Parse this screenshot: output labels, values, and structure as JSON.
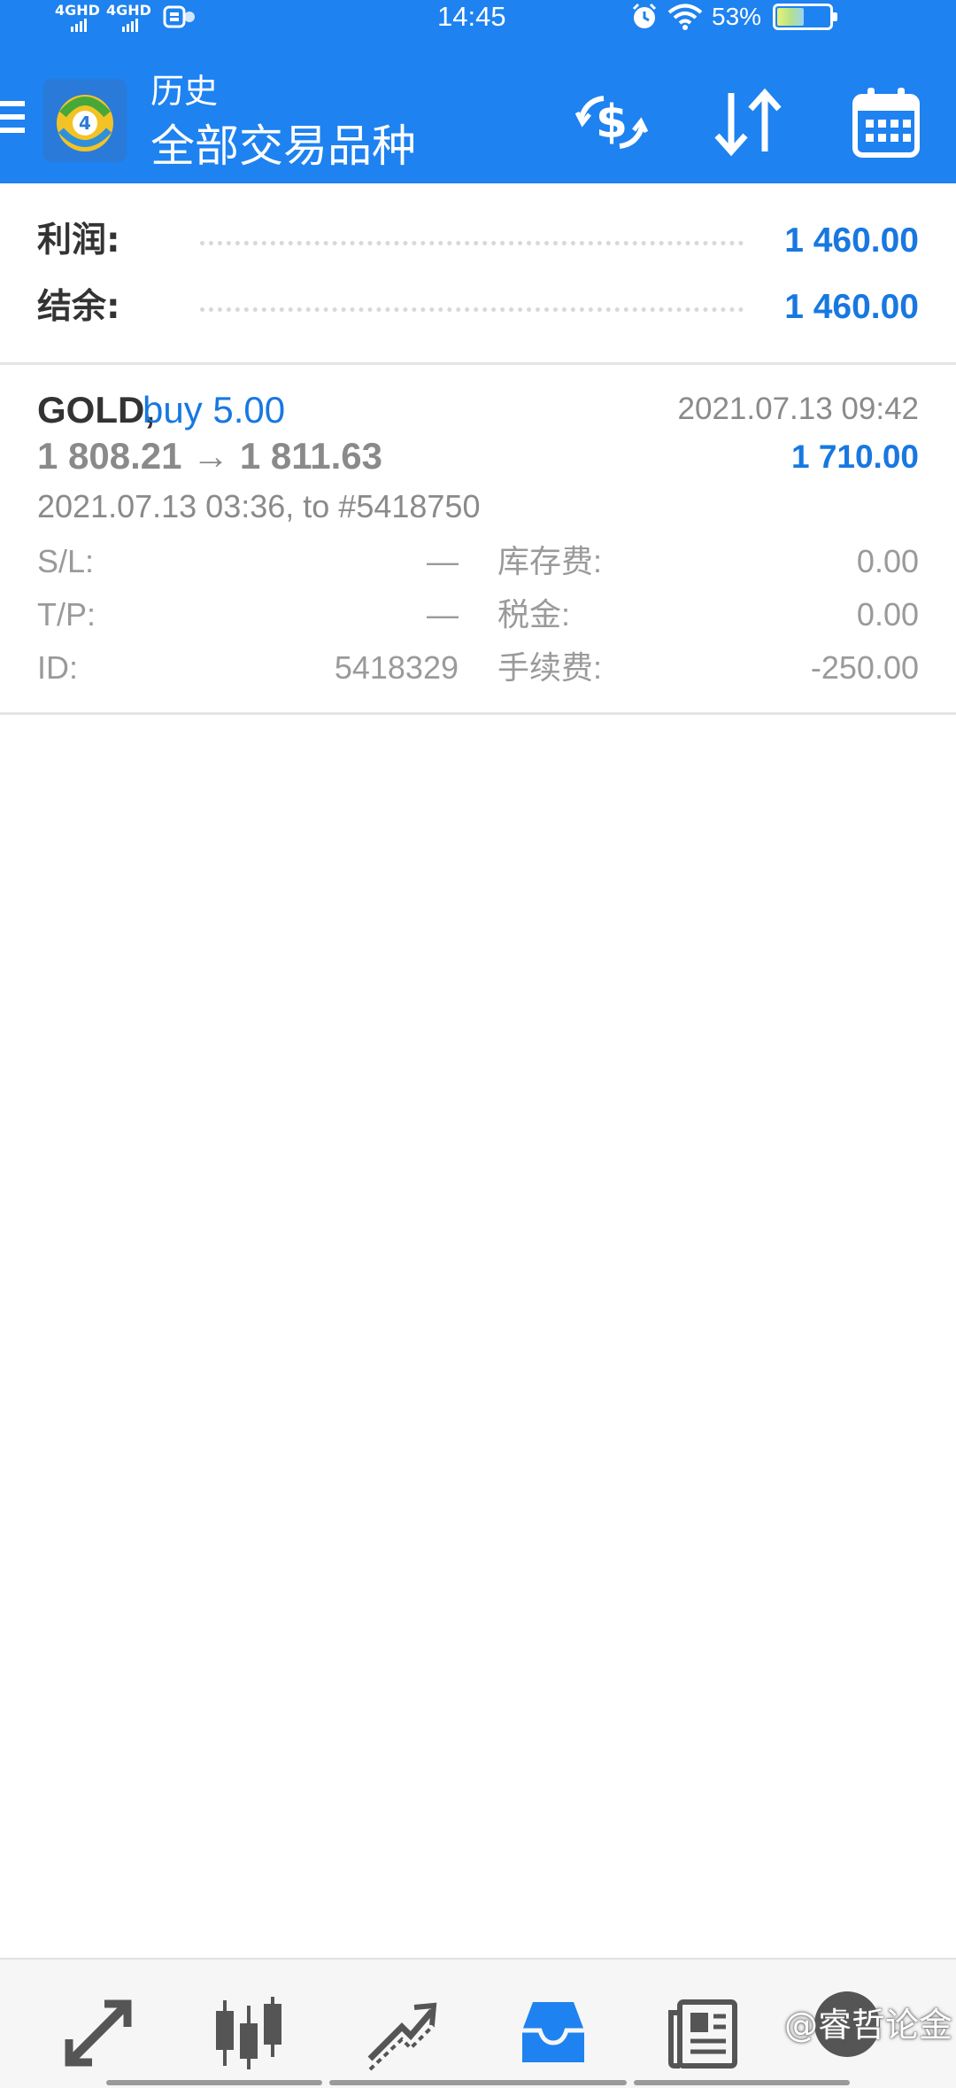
{
  "status_bar": {
    "network_1": "4GHD",
    "network_2": "4GHD",
    "time": "14:45",
    "battery_pct": "53%"
  },
  "header": {
    "title": "历史",
    "subtitle": "全部交易品种",
    "icons": [
      "menu-icon",
      "balance-operations-icon",
      "sort-icon",
      "calendar-icon"
    ]
  },
  "summary": {
    "profit_label": "利润:",
    "profit_value": "1 460.00",
    "balance_label": "结余:",
    "balance_value": "1 460.00"
  },
  "trades": [
    {
      "symbol": "GOLD,",
      "side": "buy 5.00",
      "price_line": "1 808.21 → 1 811.63",
      "close_time": "2021.07.13 09:42",
      "profit": "1 710.00",
      "open_info": "2021.07.13 03:36, to #5418750",
      "sl_label": "S/L:",
      "sl_value": "—",
      "tp_label": "T/P:",
      "tp_value": "—",
      "id_label": "ID:",
      "id_value": "5418329",
      "swap_label": "库存费:",
      "swap_value": "0.00",
      "tax_label": "税金:",
      "tax_value": "0.00",
      "commission_label": "手续费:",
      "commission_value": "-250.00"
    }
  ],
  "bottom_nav": {
    "items": [
      "quotes-icon",
      "chart-icon",
      "trade-icon",
      "history-icon",
      "news-icon",
      "messages-icon"
    ],
    "active": "history-icon"
  },
  "watermark": "@睿哲论金",
  "colors": {
    "header_bg": "#1e82f0",
    "accent": "#1878e0",
    "muted_text": "#8a8a8a"
  }
}
